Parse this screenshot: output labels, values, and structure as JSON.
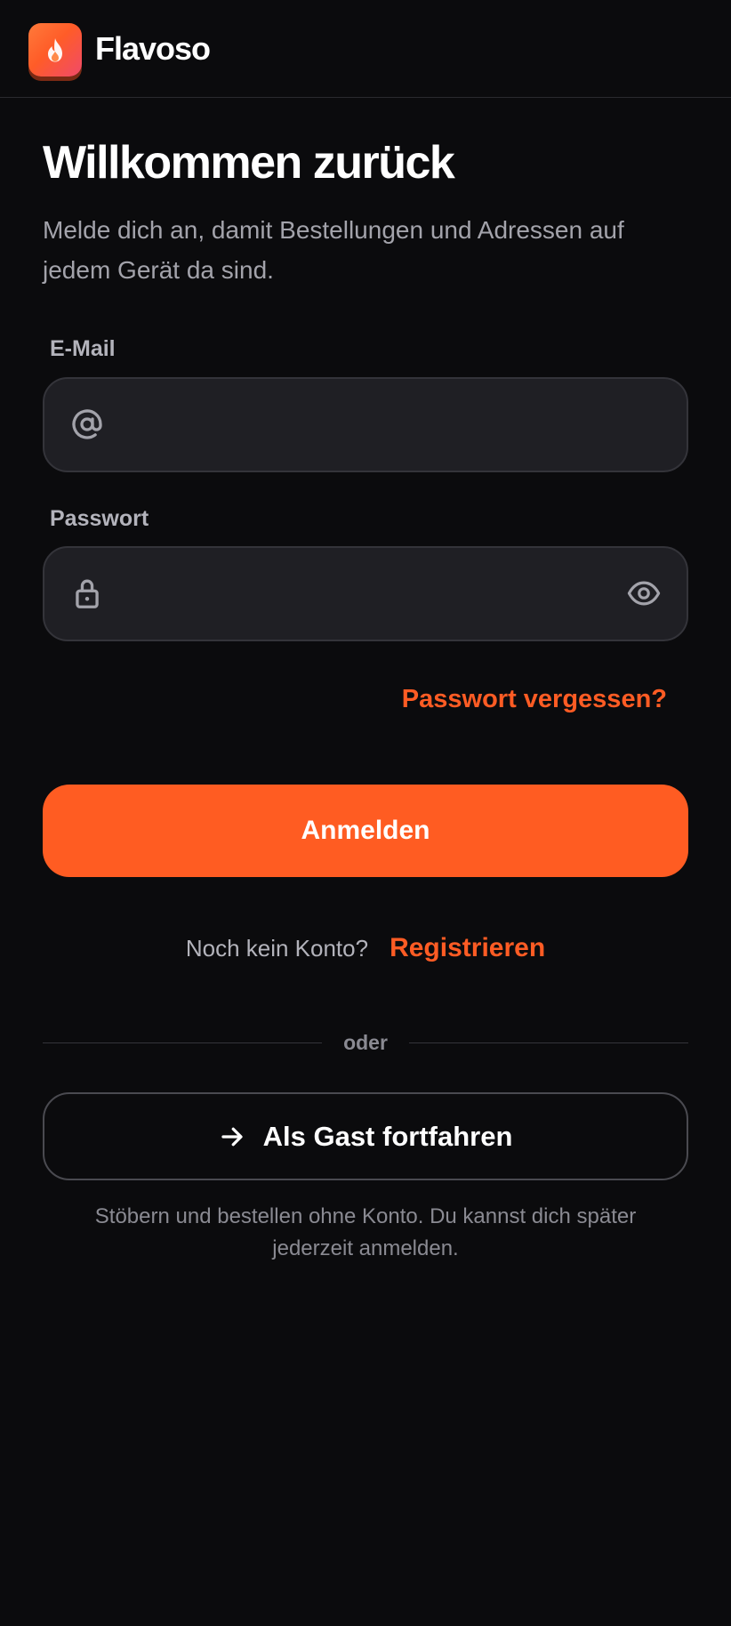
{
  "brand": {
    "name": "Flavoso",
    "logo_icon": "flame-icon",
    "accent_color": "#ff5c22"
  },
  "login": {
    "title": "Willkommen zurück",
    "subtitle": "Melde dich an, damit Bestellungen und Adressen auf jedem Gerät da sind.",
    "email": {
      "label": "E-Mail",
      "value": "",
      "placeholder": "",
      "icon": "at-sign-icon"
    },
    "password": {
      "label": "Passwort",
      "value": "",
      "placeholder": "",
      "icon": "lock-icon",
      "toggle_icon": "eye-icon"
    },
    "forgot_password": "Passwort vergessen?",
    "submit_label": "Anmelden",
    "no_account_text": "Noch kein Konto?",
    "register_label": "Registrieren",
    "divider_text": "oder",
    "guest": {
      "label": "Als Gast fortfahren",
      "icon": "arrow-right-icon",
      "note": "Stöbern und bestellen ohne Konto. Du kannst dich später jederzeit anmelden."
    }
  }
}
